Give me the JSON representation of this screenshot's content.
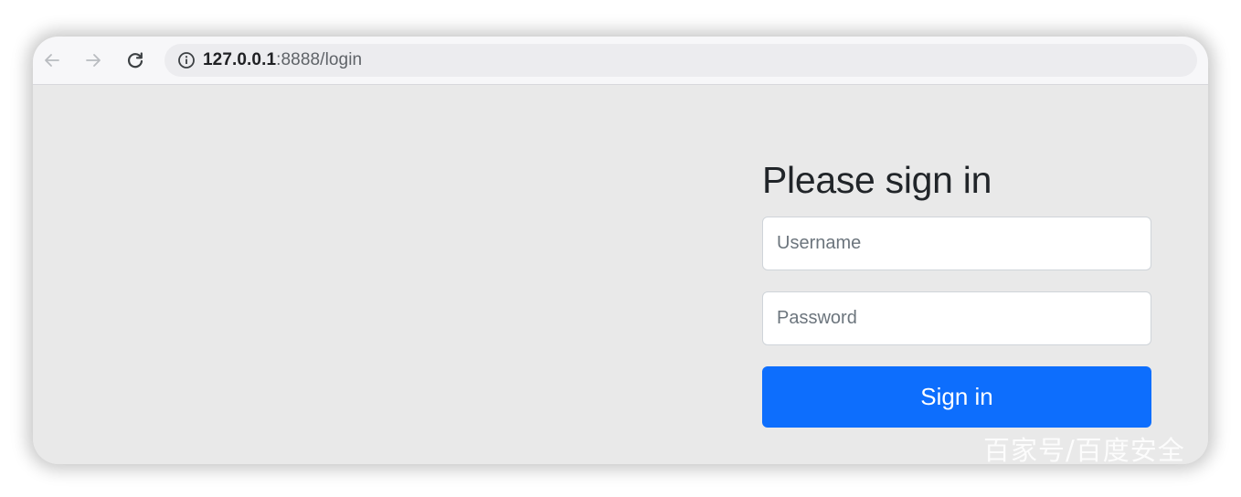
{
  "browser": {
    "url_host": "127.0.0.1",
    "url_rest": ":8888/login",
    "back_icon": "arrow-left-icon",
    "forward_icon": "arrow-right-icon",
    "reload_icon": "reload-icon",
    "info_icon": "info-circle-icon"
  },
  "login": {
    "heading": "Please sign in",
    "username_placeholder": "Username",
    "password_placeholder": "Password",
    "signin_label": "Sign in"
  },
  "watermark": "百家号/百度安全",
  "colors": {
    "primary": "#0d6efd",
    "page_bg": "#e9e9e9",
    "toolbar_bg": "#f7f7f9"
  }
}
